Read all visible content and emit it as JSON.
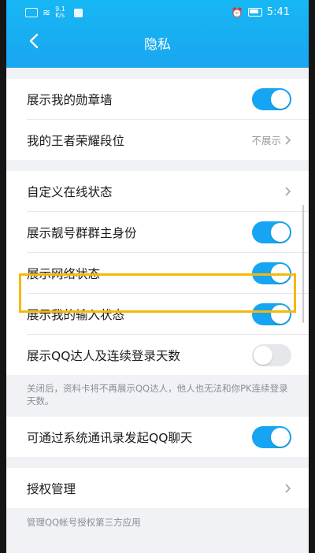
{
  "status_bar": {
    "speed": "9.1 K/s",
    "time": "5:41"
  },
  "header": {
    "title": "隐私"
  },
  "group1": [
    {
      "label": "展示我的勋章墙",
      "type": "toggle",
      "on": true
    },
    {
      "label": "我的王者荣耀段位",
      "type": "link",
      "value": "不展示"
    }
  ],
  "group2": [
    {
      "label": "自定义在线状态",
      "type": "link"
    },
    {
      "label": "展示靓号群群主身份",
      "type": "toggle",
      "on": true
    },
    {
      "label": "展示网络状态",
      "type": "toggle",
      "on": true
    },
    {
      "label": "展示我的输入状态",
      "type": "toggle",
      "on": true
    },
    {
      "label": "展示QQ达人及连续登录天数",
      "type": "toggle",
      "on": false
    }
  ],
  "group2_note": "关闭后，资料卡将不再展示QQ达人，他人也无法和你PK连续登录天数。",
  "group3": [
    {
      "label": "可通过系统通讯录发起QQ聊天",
      "type": "toggle",
      "on": true
    }
  ],
  "group4": [
    {
      "label": "授权管理",
      "type": "link"
    }
  ],
  "group4_note": "管理QQ帐号授权第三方应用",
  "colors": {
    "accent": "#16a5f2",
    "highlight": "#f5b90c"
  }
}
